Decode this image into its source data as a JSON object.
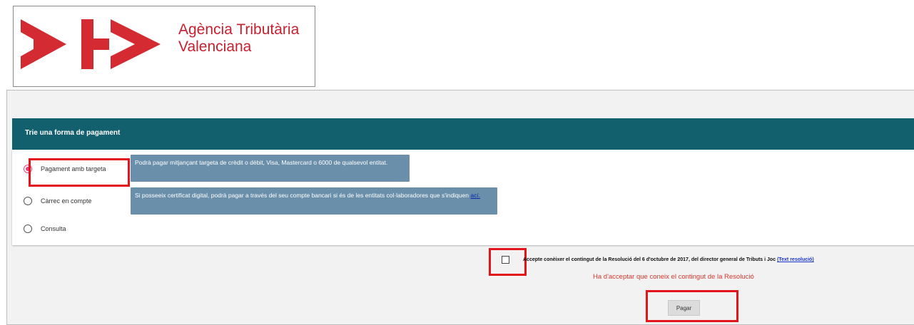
{
  "brand": {
    "name_line1": "Agència Tributària",
    "name_line2": "Valenciana",
    "accent_color": "#c8202e"
  },
  "payment_section": {
    "title": "Trie una forma de pagament",
    "header_color": "#125f6e",
    "options": [
      {
        "label": "Pagament amb targeta",
        "selected": true,
        "tooltip": "Podrà pagar mitjançant targeta de crèdit o dèbit, Visa, Mastercard o 6000 de qualsevol entitat."
      },
      {
        "label": "Càrrec en compte",
        "selected": false,
        "tooltip": "Si posseeix certificat digital, podrà pagar a través del seu compte bancari si és de les entitats col·laboradores que s'indiquen",
        "tooltip_link": "ací."
      },
      {
        "label": "Consulta",
        "selected": false
      }
    ]
  },
  "agreement": {
    "text": "Accepte conèixer el contingut de la Resolució del 6 d'octubre de 2017, del director general de Tributs i Joc",
    "link": "(Text resolució)",
    "checked": false,
    "error": "Ha d'acceptar que coneix el contingut de la Resolució"
  },
  "actions": {
    "pay_label": "Pagar"
  },
  "highlight_color": "#e3141c"
}
